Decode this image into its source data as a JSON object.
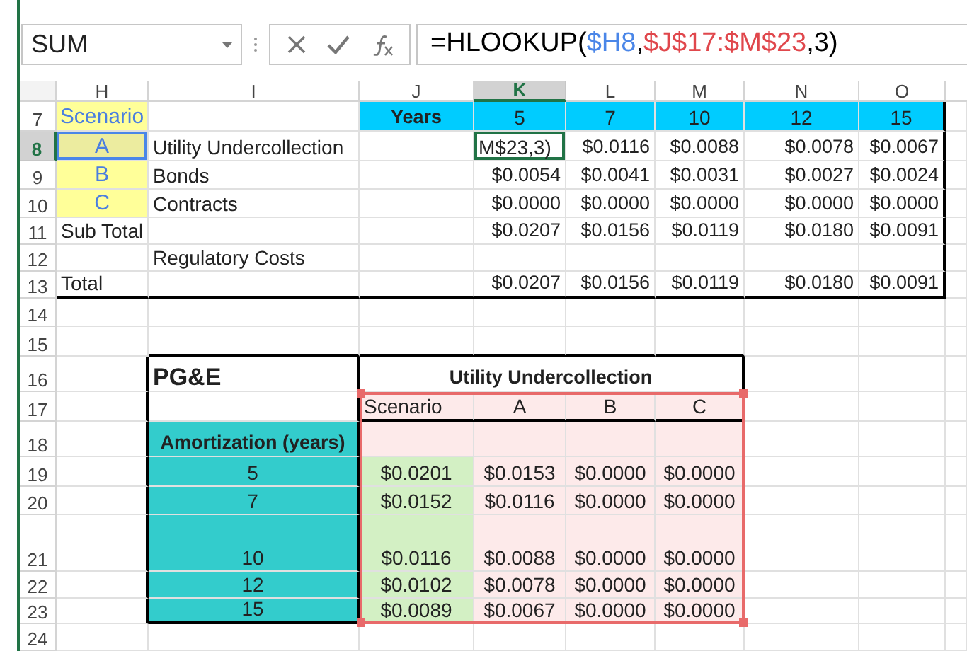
{
  "name_box": {
    "value": "SUM"
  },
  "formula_bar": {
    "segments": [
      {
        "prefix": "=HLOOKUP(",
        "ref": "$H8",
        "color": "#4a86e8"
      },
      {
        "prefix": ",",
        "ref": "$J$17:$M$23",
        "color": "#e0474c",
        "suffix": ",3)"
      }
    ]
  },
  "columns": [
    {
      "label": "H",
      "selected": false
    },
    {
      "label": "I",
      "selected": false
    },
    {
      "label": "J",
      "selected": false
    },
    {
      "label": "K",
      "selected": true
    },
    {
      "label": "L",
      "selected": false
    },
    {
      "label": "M",
      "selected": false
    },
    {
      "label": "N",
      "selected": false
    },
    {
      "label": "O",
      "selected": false
    }
  ],
  "row_headers": [
    {
      "label": "7",
      "selected": false
    },
    {
      "label": "8",
      "selected": true
    },
    {
      "label": "9",
      "selected": false
    },
    {
      "label": "10",
      "selected": false
    },
    {
      "label": "11",
      "selected": false
    },
    {
      "label": "12",
      "selected": false
    },
    {
      "label": "13",
      "selected": false
    },
    {
      "label": "14",
      "selected": false
    },
    {
      "label": "15",
      "selected": false
    },
    {
      "label": "16",
      "selected": false
    },
    {
      "label": "17",
      "selected": false
    },
    {
      "label": "18",
      "selected": false
    },
    {
      "label": "19",
      "selected": false
    },
    {
      "label": "20",
      "selected": false
    },
    {
      "label": "21",
      "selected": false
    },
    {
      "label": "22",
      "selected": false
    },
    {
      "label": "23",
      "selected": false
    },
    {
      "label": "24",
      "selected": false
    }
  ],
  "top_table": {
    "header": {
      "scenario": "Scenario",
      "years_label": "Years",
      "years": [
        "5",
        "7",
        "10",
        "12",
        "15"
      ]
    },
    "rows": [
      {
        "scenario": "A",
        "referenced": true,
        "editing": true,
        "item": "Utility Undercollection",
        "values": [
          "M$23,3)",
          "$0.0116",
          "$0.0088",
          "$0.0078",
          "$0.0067"
        ]
      },
      {
        "scenario": "B",
        "referenced": false,
        "editing": false,
        "item": "Bonds",
        "values": [
          "$0.0054",
          "$0.0041",
          "$0.0031",
          "$0.0027",
          "$0.0024"
        ]
      },
      {
        "scenario": "C",
        "referenced": false,
        "editing": false,
        "item": "Contracts",
        "values": [
          "$0.0000",
          "$0.0000",
          "$0.0000",
          "$0.0000",
          "$0.0000"
        ]
      },
      {
        "label": "Sub Total",
        "values": [
          "$0.0207",
          "$0.0156",
          "$0.0119",
          "$0.0180",
          "$0.0091"
        ]
      },
      {
        "item": "Regulatory Costs"
      },
      {
        "label": "Total",
        "values": [
          "$0.0207",
          "$0.0156",
          "$0.0119",
          "$0.0180",
          "$0.0091"
        ]
      }
    ]
  },
  "pge_table": {
    "title": "PG&E",
    "group_title": "Utility Undercollection",
    "scenario_label": "Scenario",
    "scenarios": [
      "A",
      "B",
      "C"
    ],
    "axis_label": "Amortization (years)",
    "rows": [
      {
        "years": "5",
        "values": [
          "$0.0201",
          "$0.0153",
          "$0.0000",
          "$0.0000"
        ]
      },
      {
        "years": "7",
        "values": [
          "$0.0152",
          "$0.0116",
          "$0.0000",
          "$0.0000"
        ]
      },
      {
        "years": "10",
        "values": [
          "$0.0116",
          "$0.0088",
          "$0.0000",
          "$0.0000"
        ]
      },
      {
        "years": "12",
        "values": [
          "$0.0102",
          "$0.0078",
          "$0.0000",
          "$0.0000"
        ]
      },
      {
        "years": "15",
        "values": [
          "$0.0089",
          "$0.0067",
          "$0.0000",
          "$0.0000"
        ]
      }
    ]
  }
}
